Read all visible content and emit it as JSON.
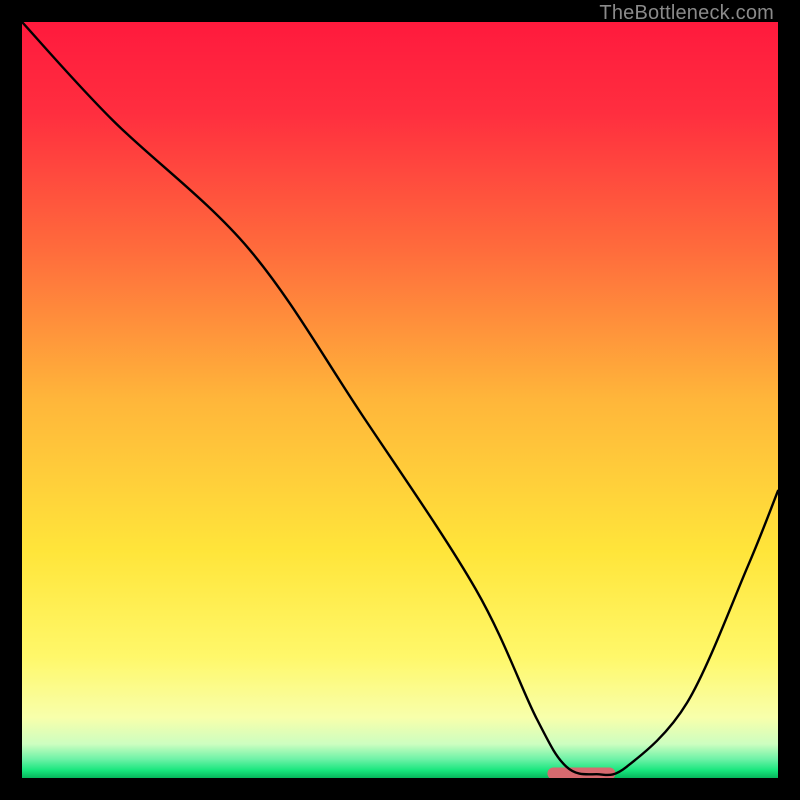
{
  "watermark": "TheBottleneck.com",
  "chart_data": {
    "type": "line",
    "title": "",
    "xlabel": "",
    "ylabel": "",
    "xlim": [
      0,
      100
    ],
    "ylim": [
      0,
      100
    ],
    "grid": false,
    "legend": false,
    "annotations": [],
    "series": [
      {
        "name": "curve",
        "x": [
          0,
          12,
          30,
          45,
          60,
          68,
          72,
          76,
          80,
          88,
          96,
          100
        ],
        "y": [
          100,
          87,
          70,
          48,
          25,
          8,
          1.5,
          0.5,
          1.5,
          10,
          28,
          38
        ]
      }
    ],
    "marker": {
      "name": "target-bar",
      "x_center": 74,
      "width": 9,
      "y": 0.6,
      "color": "#d66a6f"
    },
    "gradient_stops": [
      {
        "offset": 0.0,
        "color": "#ff1a3d"
      },
      {
        "offset": 0.12,
        "color": "#ff2e3f"
      },
      {
        "offset": 0.3,
        "color": "#ff6b3c"
      },
      {
        "offset": 0.5,
        "color": "#ffb63a"
      },
      {
        "offset": 0.7,
        "color": "#ffe53a"
      },
      {
        "offset": 0.84,
        "color": "#fff86a"
      },
      {
        "offset": 0.92,
        "color": "#f8ffab"
      },
      {
        "offset": 0.955,
        "color": "#cdfec0"
      },
      {
        "offset": 0.975,
        "color": "#6ef2a7"
      },
      {
        "offset": 0.99,
        "color": "#17e67d"
      },
      {
        "offset": 1.0,
        "color": "#06b65c"
      }
    ]
  }
}
